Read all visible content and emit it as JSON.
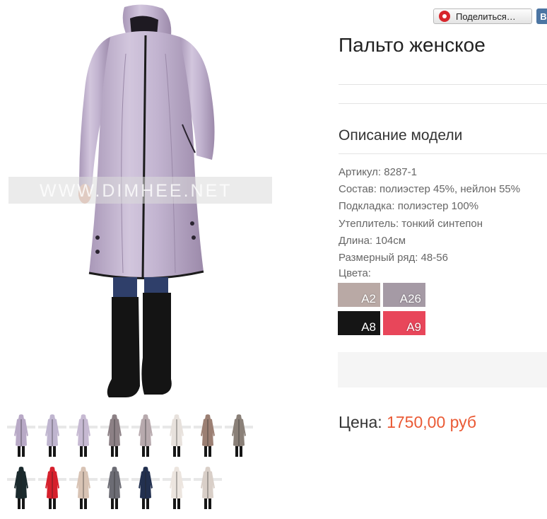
{
  "share": {
    "label": "Поделиться…",
    "vk_label": "В"
  },
  "product": {
    "title": "Пальто женское",
    "description_title": "Описание модели",
    "specs": [
      "Артикул: 8287-1",
      "Состав: полиэстер 45%, нейлон 55%",
      "Подкладка: полиэстер 100%",
      "Утеплитель: тонкий синтепон",
      "Длина: 104см",
      "Размерный ряд: 48-56"
    ],
    "colors_label": "Цвета:",
    "colors": [
      {
        "code": "A2",
        "hex": "#b9a9a5"
      },
      {
        "code": "A26",
        "hex": "#a59aa5"
      },
      {
        "code": "A8",
        "hex": "#151515"
      },
      {
        "code": "A9",
        "hex": "#e8465a"
      }
    ],
    "price_label": "Цена:",
    "price_value": "1750,00 руб"
  },
  "watermark": "WWW.DIMHEE.NET",
  "thumbnails": {
    "row1": [
      "#b8a9c6",
      "#bfb5cf",
      "#c6b9d2",
      "#8c8085",
      "#b7a9ad",
      "#e7e1dc",
      "#9b7f73",
      "#8a8078"
    ],
    "row2": [
      "#1b2a2d",
      "#d6202c",
      "#d8c3b4",
      "#6c6c74",
      "#22304f",
      "#ece5df",
      "#d9cfc8"
    ]
  },
  "colors": {
    "price": "#ea5a35",
    "accent_share": "#d7262c",
    "vk": "#4c75a3"
  }
}
